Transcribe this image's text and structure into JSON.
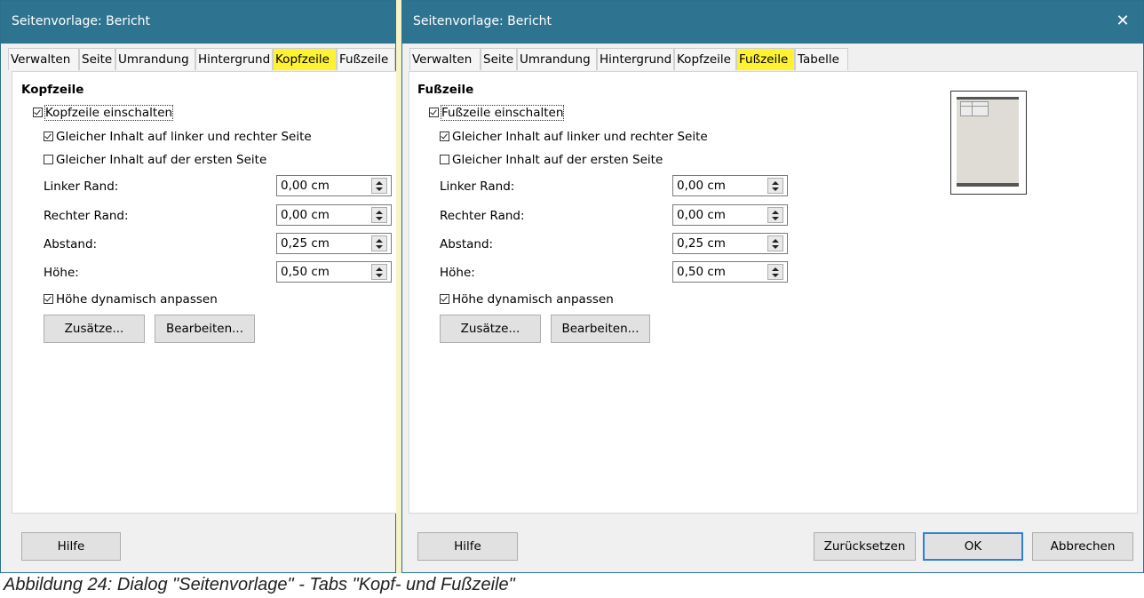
{
  "left_dialog": {
    "title": "Seitenvorlage: Bericht",
    "tabs": [
      {
        "label": "Verwalten",
        "active": false
      },
      {
        "label": "Seite",
        "active": false
      },
      {
        "label": "Umrandung",
        "active": false
      },
      {
        "label": "Hintergrund",
        "active": false
      },
      {
        "label": "Kopfzeile",
        "active": true
      },
      {
        "label": "Fußzeile",
        "active": false
      }
    ],
    "section_title": "Kopfzeile",
    "enable": {
      "label": "Kopfzeile einschalten",
      "checked": true
    },
    "same_content_lr": {
      "label": "Gleicher Inhalt auf linker und rechter Seite",
      "checked": true
    },
    "same_content_first": {
      "label": "Gleicher Inhalt auf der ersten Seite",
      "checked": false
    },
    "fields": [
      {
        "label": "Linker Rand:",
        "value": "0,00 cm"
      },
      {
        "label": "Rechter Rand:",
        "value": "0,00 cm"
      },
      {
        "label": "Abstand:",
        "value": "0,25 cm"
      },
      {
        "label": "Höhe:",
        "value": "0,50 cm"
      }
    ],
    "autofit": {
      "label": "Höhe dynamisch anpassen",
      "checked": true
    },
    "more_button": "Zusätze...",
    "edit_button": "Bearbeiten...",
    "help_button": "Hilfe"
  },
  "right_dialog": {
    "title": "Seitenvorlage: Bericht",
    "close_glyph": "✕",
    "tabs": [
      {
        "label": "Verwalten",
        "active": false
      },
      {
        "label": "Seite",
        "active": false
      },
      {
        "label": "Umrandung",
        "active": false
      },
      {
        "label": "Hintergrund",
        "active": false
      },
      {
        "label": "Kopfzeile",
        "active": false
      },
      {
        "label": "Fußzeile",
        "active": true
      },
      {
        "label": "Tabelle",
        "active": false
      }
    ],
    "section_title": "Fußzeile",
    "enable": {
      "label": "Fußzeile einschalten",
      "checked": true
    },
    "same_content_lr": {
      "label": "Gleicher Inhalt auf linker und rechter Seite",
      "checked": true
    },
    "same_content_first": {
      "label": "Gleicher Inhalt auf der ersten Seite",
      "checked": false
    },
    "fields": [
      {
        "label": "Linker Rand:",
        "value": "0,00 cm"
      },
      {
        "label": "Rechter Rand:",
        "value": "0,00 cm"
      },
      {
        "label": "Abstand:",
        "value": "0,25 cm"
      },
      {
        "label": "Höhe:",
        "value": "0,50 cm"
      }
    ],
    "autofit": {
      "label": "Höhe dynamisch anpassen",
      "checked": true
    },
    "more_button": "Zusätze...",
    "edit_button": "Bearbeiten...",
    "help_button": "Hilfe",
    "reset_button": "Zurücksetzen",
    "ok_button": "OK",
    "cancel_button": "Abbrechen"
  },
  "caption": "Abbildung 24: Dialog \"Seitenvorlage\" - Tabs \"Kopf- und Fußzeile\"",
  "colors": {
    "titlebar": "#2e7491",
    "tab_highlight": "#fff233",
    "default_button_border": "#2f7fd6"
  }
}
